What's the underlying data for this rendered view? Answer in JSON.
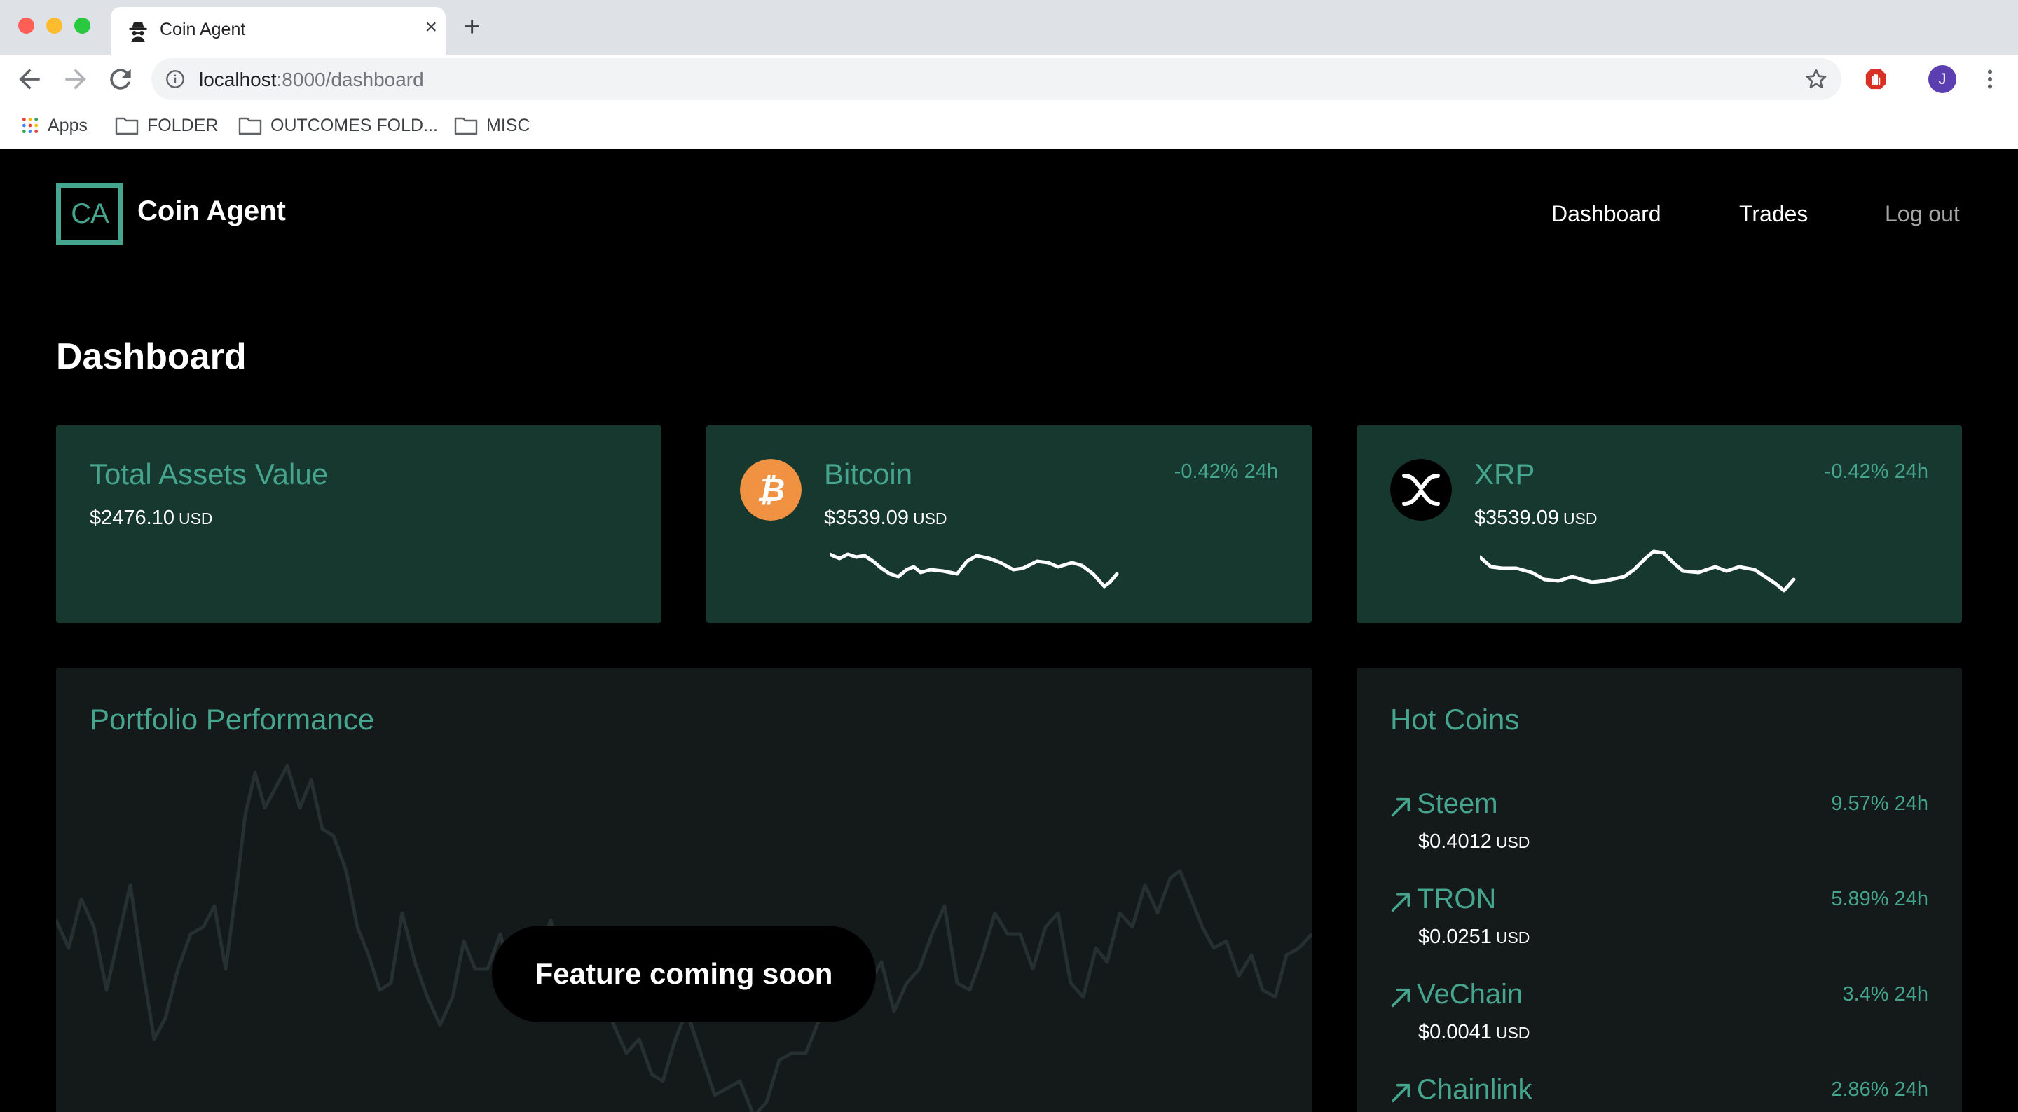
{
  "browser": {
    "tab_title": "Coin Agent",
    "tab_close": "×",
    "new_tab": "+",
    "url_host": "localhost",
    "url_path": ":8000/dashboard",
    "avatar_initial": "J",
    "bookmarks": [
      {
        "label": "Apps",
        "icon": "apps-grid-icon"
      },
      {
        "label": "FOLDER",
        "icon": "folder-icon"
      },
      {
        "label": "OUTCOMES FOLD...",
        "icon": "folder-icon"
      },
      {
        "label": "MISC",
        "icon": "folder-icon"
      }
    ]
  },
  "header": {
    "logo_text": "CA",
    "brand": "Coin Agent",
    "nav": [
      "Dashboard",
      "Trades",
      "Log out"
    ]
  },
  "page": {
    "title": "Dashboard"
  },
  "cards": {
    "total": {
      "title": "Total Assets Value",
      "value": "$2476.10",
      "unit": "USD"
    },
    "bitcoin": {
      "name": "Bitcoin",
      "price": "$3539.09",
      "unit": "USD",
      "change": "-0.42% 24h",
      "icon": "bitcoin-icon",
      "color": "#f09242"
    },
    "xrp": {
      "name": "XRP",
      "price": "$3539.09",
      "unit": "USD",
      "change": "-0.42% 24h",
      "icon": "xrp-icon",
      "color": "#000000"
    }
  },
  "portfolio": {
    "title": "Portfolio Performance",
    "overlay": "Feature coming soon"
  },
  "hot_coins": {
    "title": "Hot Coins",
    "items": [
      {
        "name": "Steem",
        "change": "9.57% 24h",
        "price": "$0.4012",
        "unit": "USD"
      },
      {
        "name": "TRON",
        "change": "5.89% 24h",
        "price": "$0.0251",
        "unit": "USD"
      },
      {
        "name": "VeChain",
        "change": "3.4% 24h",
        "price": "$0.0041",
        "unit": "USD"
      },
      {
        "name": "Chainlink",
        "change": "2.86% 24h",
        "price": "",
        "unit": ""
      }
    ]
  },
  "colors": {
    "accent": "#46a58e",
    "card": "#17382f",
    "card_dark": "#131a19",
    "background": "#000000"
  }
}
